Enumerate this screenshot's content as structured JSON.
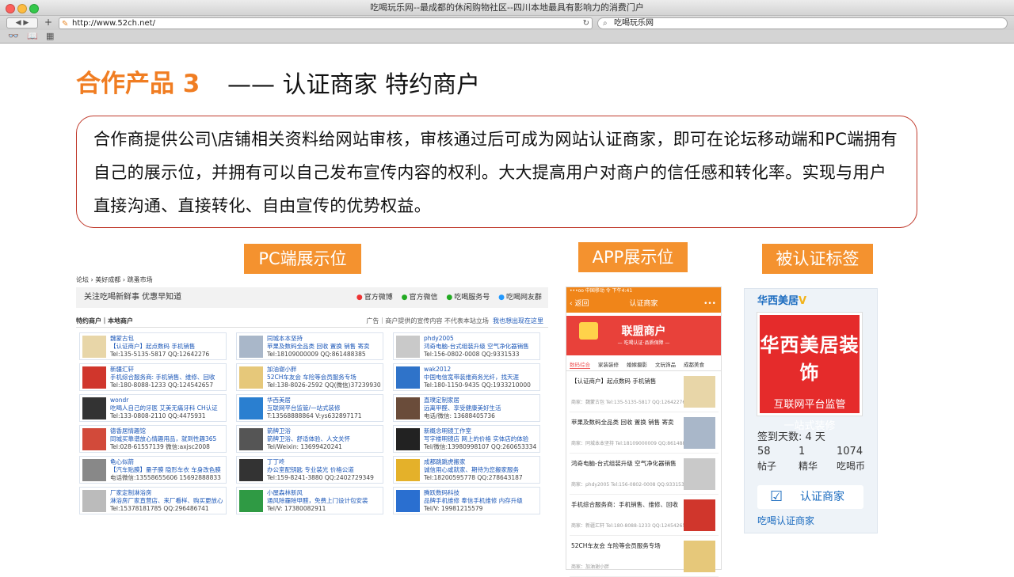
{
  "browser": {
    "title": "吃喝玩乐网--最成都的休闲购物社区--四川本地最具有影响力的消费门户",
    "url": "http://www.52ch.net/",
    "search": "吃喝玩乐网",
    "colors": {
      "close": "#fc605c",
      "min": "#fdbc40",
      "max": "#34c84a"
    }
  },
  "slide": {
    "heading": "合作产品 3",
    "subheading": "—— 认证商家 特约商户",
    "description": "合作商提供公司\\店铺相关资料给网站审核，审核通过后可成为网站认证商家，即可在论坛移动端和PC端拥有自己的展示位，并拥有可以自己发布宣传内容的权利。大大提高用户对商户的信任感和转化率。实现与用户直接沟通、直接转化、自由宣传的优势权益。",
    "label_pc": "PC端展示位",
    "label_app": "APP展示位",
    "label_badge": "被认证标签",
    "accent": "#f07d22"
  },
  "pc": {
    "crumb": "论坛 › 美好成都 › 跳蚤市场",
    "follow": "关注吃喝新鲜事 优惠早知道",
    "social": [
      "官方微博",
      "官方微信",
      "吃喝服务号",
      "吃喝网友群"
    ],
    "section": "特约商户｜本地商户",
    "section_right": "广告｜商户提供的宣传内容 不代表本站立场",
    "section_link": "我也想出现在这里",
    "cells": [
      {
        "n": "魏蒙古包",
        "a": "【认证商户】起点数码 手机销售",
        "c": "Tel:135-5135-5817 QQ:12642276"
      },
      {
        "n": "同城本本坚持",
        "a": "苹果及数码全品类 回收 置换 销售 寄卖",
        "c": "Tel:18109000009 QQ:861488385"
      },
      {
        "n": "phdy2005",
        "a": "鸿奇电脑-台式组装升级 空气净化器销售",
        "c": "Tel:156-0802-0008 QQ:9331533"
      },
      {
        "n": "新疆汇轩",
        "a": "手机综合服务商: 手机销售、维修、回收",
        "c": "Tel:180-8088-1233 QQ:124542657"
      },
      {
        "n": "加油谢小胖",
        "a": "52CH车友会 车险等会员服务专场",
        "c": "Tel:138-8026-2592 QQ(微信)37239930"
      },
      {
        "n": "wak2012",
        "a": "中国电信宽带装维商务光纤，找天涯",
        "c": "Tel:180-1150-9435 QQ:1933210000"
      },
      {
        "n": "wondr",
        "a": "吃喝人自己的牙医 艾美无痛牙科 CH认证",
        "c": "Tel:133-0808-2110 QQ:4475931"
      },
      {
        "n": "华西美居",
        "a": "互联网平台监管/一站式装修",
        "c": "T:13568888864 V:ys632897171"
      },
      {
        "n": "直璞定制家居",
        "a": "远离甲醛、享受健康美好生活",
        "c": "电话/微信: 13688405736"
      },
      {
        "n": "德香居情趣馆",
        "a": "同城买靠谱放心情趣用品，就到性趣365",
        "c": "Tel:028-61557139 微信:axjsc2008"
      },
      {
        "n": "箭牌卫浴",
        "a": "箭牌卫浴、舒适体验、人文关怀",
        "c": "Tel/Weixin: 13699420241"
      },
      {
        "n": "新概念明镜工作室",
        "a": "写字楼明镜店 网上的价格 实体店的体验",
        "c": "Tel/微信:13980998107 QQ:260653334"
      },
      {
        "n": "龟心似箭",
        "a": "【汽车贴膜】量子膜 隐形车衣 车身改色膜",
        "c": "电话微信:13558655606 15692888833"
      },
      {
        "n": "丁丁咚",
        "a": "办公室配钥匙 专业装光 价格公道",
        "c": "Tel:159-8241-3880 QQ:2402729349"
      },
      {
        "n": "成都跳跳虎搬家",
        "a": "诚信用心或就家、期待为您搬家服务",
        "c": "Tel:18200595778 QQ:278643187"
      },
      {
        "n": "厂家定制淋浴房",
        "a": "淋浴房厂家直营店、来厂看样、购买更放心",
        "c": "Tel:15378181785 QQ:296486741"
      },
      {
        "n": "小屋森林新风",
        "a": "通风除霾除甲醛，免费上门设计包安装",
        "c": "Tel/V: 17380082911"
      },
      {
        "n": "腾跃数码科技",
        "a": "品牌手机维修 奉信手机维修 内存升级",
        "c": "Tel/V: 19981215579"
      }
    ]
  },
  "app": {
    "status": "•••oo 中国移动 令  下午4:41",
    "back": "返回",
    "title": "认证商家",
    "banner": "联盟商户",
    "banner_sub": "— 吃喝认证·品质保障 —",
    "tabs": [
      "数码综合",
      "家装装修",
      "婚嫁摄影",
      "文玩饰品",
      "成都美食"
    ],
    "items": [
      {
        "t": "【认证商户】起点数码 手机销售",
        "m": "商家：魏蒙古包  Tel:135-5135-5817 QQ:12642276"
      },
      {
        "t": "苹果及数码全品类 回收 置换 销售 寄卖",
        "m": "商家：同城本本坚持  Tel:18109000009 QQ:861488385"
      },
      {
        "t": "鸿奇电脑-台式组装升级 空气净化器销售",
        "m": "商家：phdy2005  Tel:156-0802-0008 QQ:9331533"
      },
      {
        "t": "手机综合服务商：手机销售、维修、回收",
        "m": "商家：新疆汇轩  Tel:180-8088-1233 QQ:124542657"
      },
      {
        "t": "52CH车友会 车险等会员服务专场",
        "m": "商家：加油谢小胖"
      }
    ]
  },
  "badge": {
    "name": "华西美居",
    "logo_main": "华西美居装饰",
    "logo_l2": "互联网平台监管",
    "logo_l3": "一站式装修",
    "days": "签到天数: 4 天",
    "stats": [
      {
        "v": "58",
        "k": "帖子"
      },
      {
        "v": "1",
        "k": "精华"
      },
      {
        "v": "1074",
        "k": "吃喝币"
      }
    ],
    "rz_button": "认证商家",
    "rz_label": "吃喝认证商家"
  }
}
